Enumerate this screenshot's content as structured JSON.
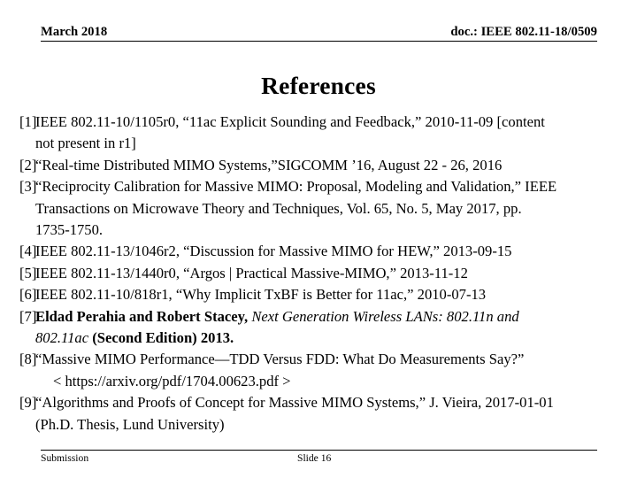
{
  "header": {
    "left": "March 2018",
    "right": "doc.: IEEE 802.11-18/0509"
  },
  "title": "References",
  "references": [
    {
      "tag": "[1]",
      "line1": "IEEE 802.11-10/1105r0, “11ac Explicit Sounding and Feedback,” 2010-11-09 [content",
      "line2": "not present in r1]"
    },
    {
      "tag": "[2]",
      "line1": "“Real-time Distributed MIMO Systems,”SIGCOMM ’16, August 22 - 26, 2016"
    },
    {
      "tag": "[3]",
      "line1": "“Reciprocity Calibration for Massive MIMO: Proposal, Modeling and Validation,” IEEE",
      "line2": "Transactions on Microwave Theory and Techniques, Vol. 65, No. 5, May 2017, pp.",
      "line3": "1735-1750."
    },
    {
      "tag": "[4]",
      "line1": "IEEE 802.11-13/1046r2, “Discussion for Massive MIMO for HEW,” 2013-09-15"
    },
    {
      "tag": "[5]",
      "line1": "IEEE 802.11-13/1440r0, “Argos | Practical Massive-MIMO,” 2013-11-12"
    },
    {
      "tag": "[6]",
      "line1": "IEEE 802.11-10/818r1, “Why Implicit TxBF is Better for 11ac,” 2010-07-13"
    },
    {
      "tag": "[7]",
      "authors": "Eldad Perahia and Robert Stacey, ",
      "book_title_line1": "Next Generation Wireless LANs: 802.11n and",
      "book_title_line2": "802.11ac",
      "edition": " (Second Edition) 2013."
    },
    {
      "tag": "[8]",
      "line1": "“Massive MIMO Performance—TDD Versus FDD: What Do Measurements Say?”",
      "url": "< https://arxiv.org/pdf/1704.00623.pdf >"
    },
    {
      "tag": "[9]",
      "line1": "“Algorithms and Proofs of Concept for Massive MIMO Systems,” J. Vieira, 2017-01-01",
      "line2": "(Ph.D. Thesis, Lund University)"
    }
  ],
  "footer": {
    "left": "Submission",
    "center": "Slide 16"
  }
}
